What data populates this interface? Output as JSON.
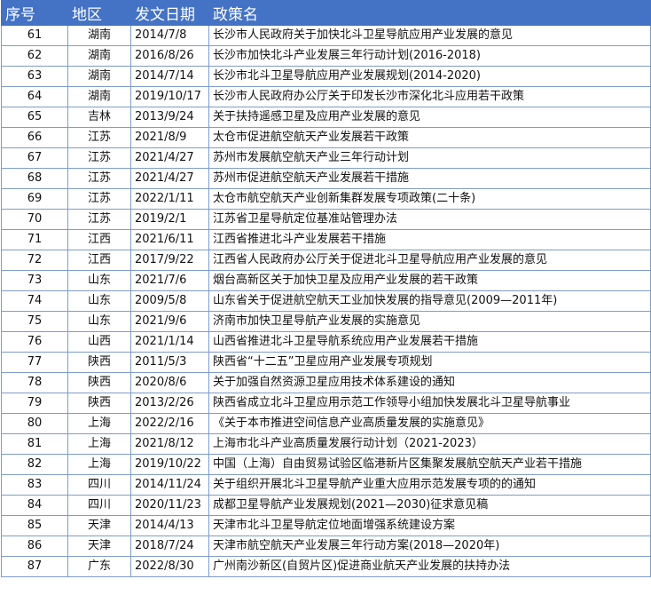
{
  "headers": [
    "序号",
    "地区",
    "发文日期",
    "政策名"
  ],
  "rows": [
    [
      "61",
      "湖南",
      "2014/7/8",
      "长沙市人民政府关于加快北斗卫星导航应用产业发展的意见"
    ],
    [
      "62",
      "湖南",
      "2016/8/26",
      "长沙市加快北斗产业发展三年行动计划(2016-2018)"
    ],
    [
      "63",
      "湖南",
      "2014/7/14",
      "长沙市北斗卫星导航应用产业发展规划(2014-2020)"
    ],
    [
      "64",
      "湖南",
      "2019/10/17",
      "长沙市人民政府办公厅关于印发长沙市深化北斗应用若干政策"
    ],
    [
      "65",
      "吉林",
      "2013/9/24",
      "关于扶持遥感卫星及应用产业发展的意见"
    ],
    [
      "66",
      "江苏",
      "2021/8/9",
      "太仓市促进航空航天产业发展若干政策"
    ],
    [
      "67",
      "江苏",
      "2021/4/27",
      "苏州市发展航空航天产业三年行动计划"
    ],
    [
      "68",
      "江苏",
      "2021/4/27",
      "苏州市促进航空航天产业发展若干措施"
    ],
    [
      "69",
      "江苏",
      "2022/1/11",
      "太仓市航空航天产业创新集群发展专项政策(二十条)"
    ],
    [
      "70",
      "江苏",
      "2019/2/1",
      "江苏省卫星导航定位基准站管理办法"
    ],
    [
      "71",
      "江西",
      "2021/6/11",
      "江西省推进北斗产业发展若干措施"
    ],
    [
      "72",
      "江西",
      "2017/9/22",
      "江西省人民政府办公厅关于促进北斗卫星导航应用产业发展的意见"
    ],
    [
      "73",
      "山东",
      "2021/7/6",
      "烟台高新区关于加快卫星及应用产业发展的若干政策"
    ],
    [
      "74",
      "山东",
      "2009/5/8",
      "山东省关于促进航空航天工业加快发展的指导意见(2009—2011年)"
    ],
    [
      "75",
      "山东",
      "2021/9/6",
      "济南市加快卫星导航产业发展的实施意见"
    ],
    [
      "76",
      "山西",
      "2021/1/14",
      "山西省推进北斗卫星导航系统应用产业发展若干措施"
    ],
    [
      "77",
      "陕西",
      "2011/5/3",
      "陕西省“十二五”卫星应用产业发展专项规划"
    ],
    [
      "78",
      "陕西",
      "2020/8/6",
      "关于加强自然资源卫星应用技术体系建设的通知"
    ],
    [
      "79",
      "陕西",
      "2013/2/26",
      "陕西省成立北斗卫星应用示范工作领导小组加快发展北斗卫星导航事业"
    ],
    [
      "80",
      "上海",
      "2022/2/16",
      "《关于本市推进空间信息产业高质量发展的实施意见》"
    ],
    [
      "81",
      "上海",
      "2021/8/12",
      "上海市北斗产业高质量发展行动计划（2021-2023）"
    ],
    [
      "82",
      "上海",
      "2019/10/22",
      "中国（上海）自由贸易试验区临港新片区集聚发展航空航天产业若干措施"
    ],
    [
      "83",
      "四川",
      "2014/11/24",
      "关于组织开展北斗卫星导航产业重大应用示范发展专项的的通知"
    ],
    [
      "84",
      "四川",
      "2020/11/23",
      "成都卫星导航产业发展规划(2021—2030)征求意见稿"
    ],
    [
      "85",
      "天津",
      "2014/4/13",
      "天津市北斗卫星导航定位地面增强系统建设方案"
    ],
    [
      "86",
      "天津",
      "2018/7/24",
      "天津市航空航天产业发展三年行动方案(2018—2020年)"
    ],
    [
      "87",
      "广东",
      "2022/8/30",
      "广州南沙新区(自贸片区)促进商业航天产业发展的扶持办法"
    ]
  ],
  "colors": {
    "header_bg": "#4472c4",
    "header_text": "#ffffff",
    "grid": "#7f9cc9"
  }
}
